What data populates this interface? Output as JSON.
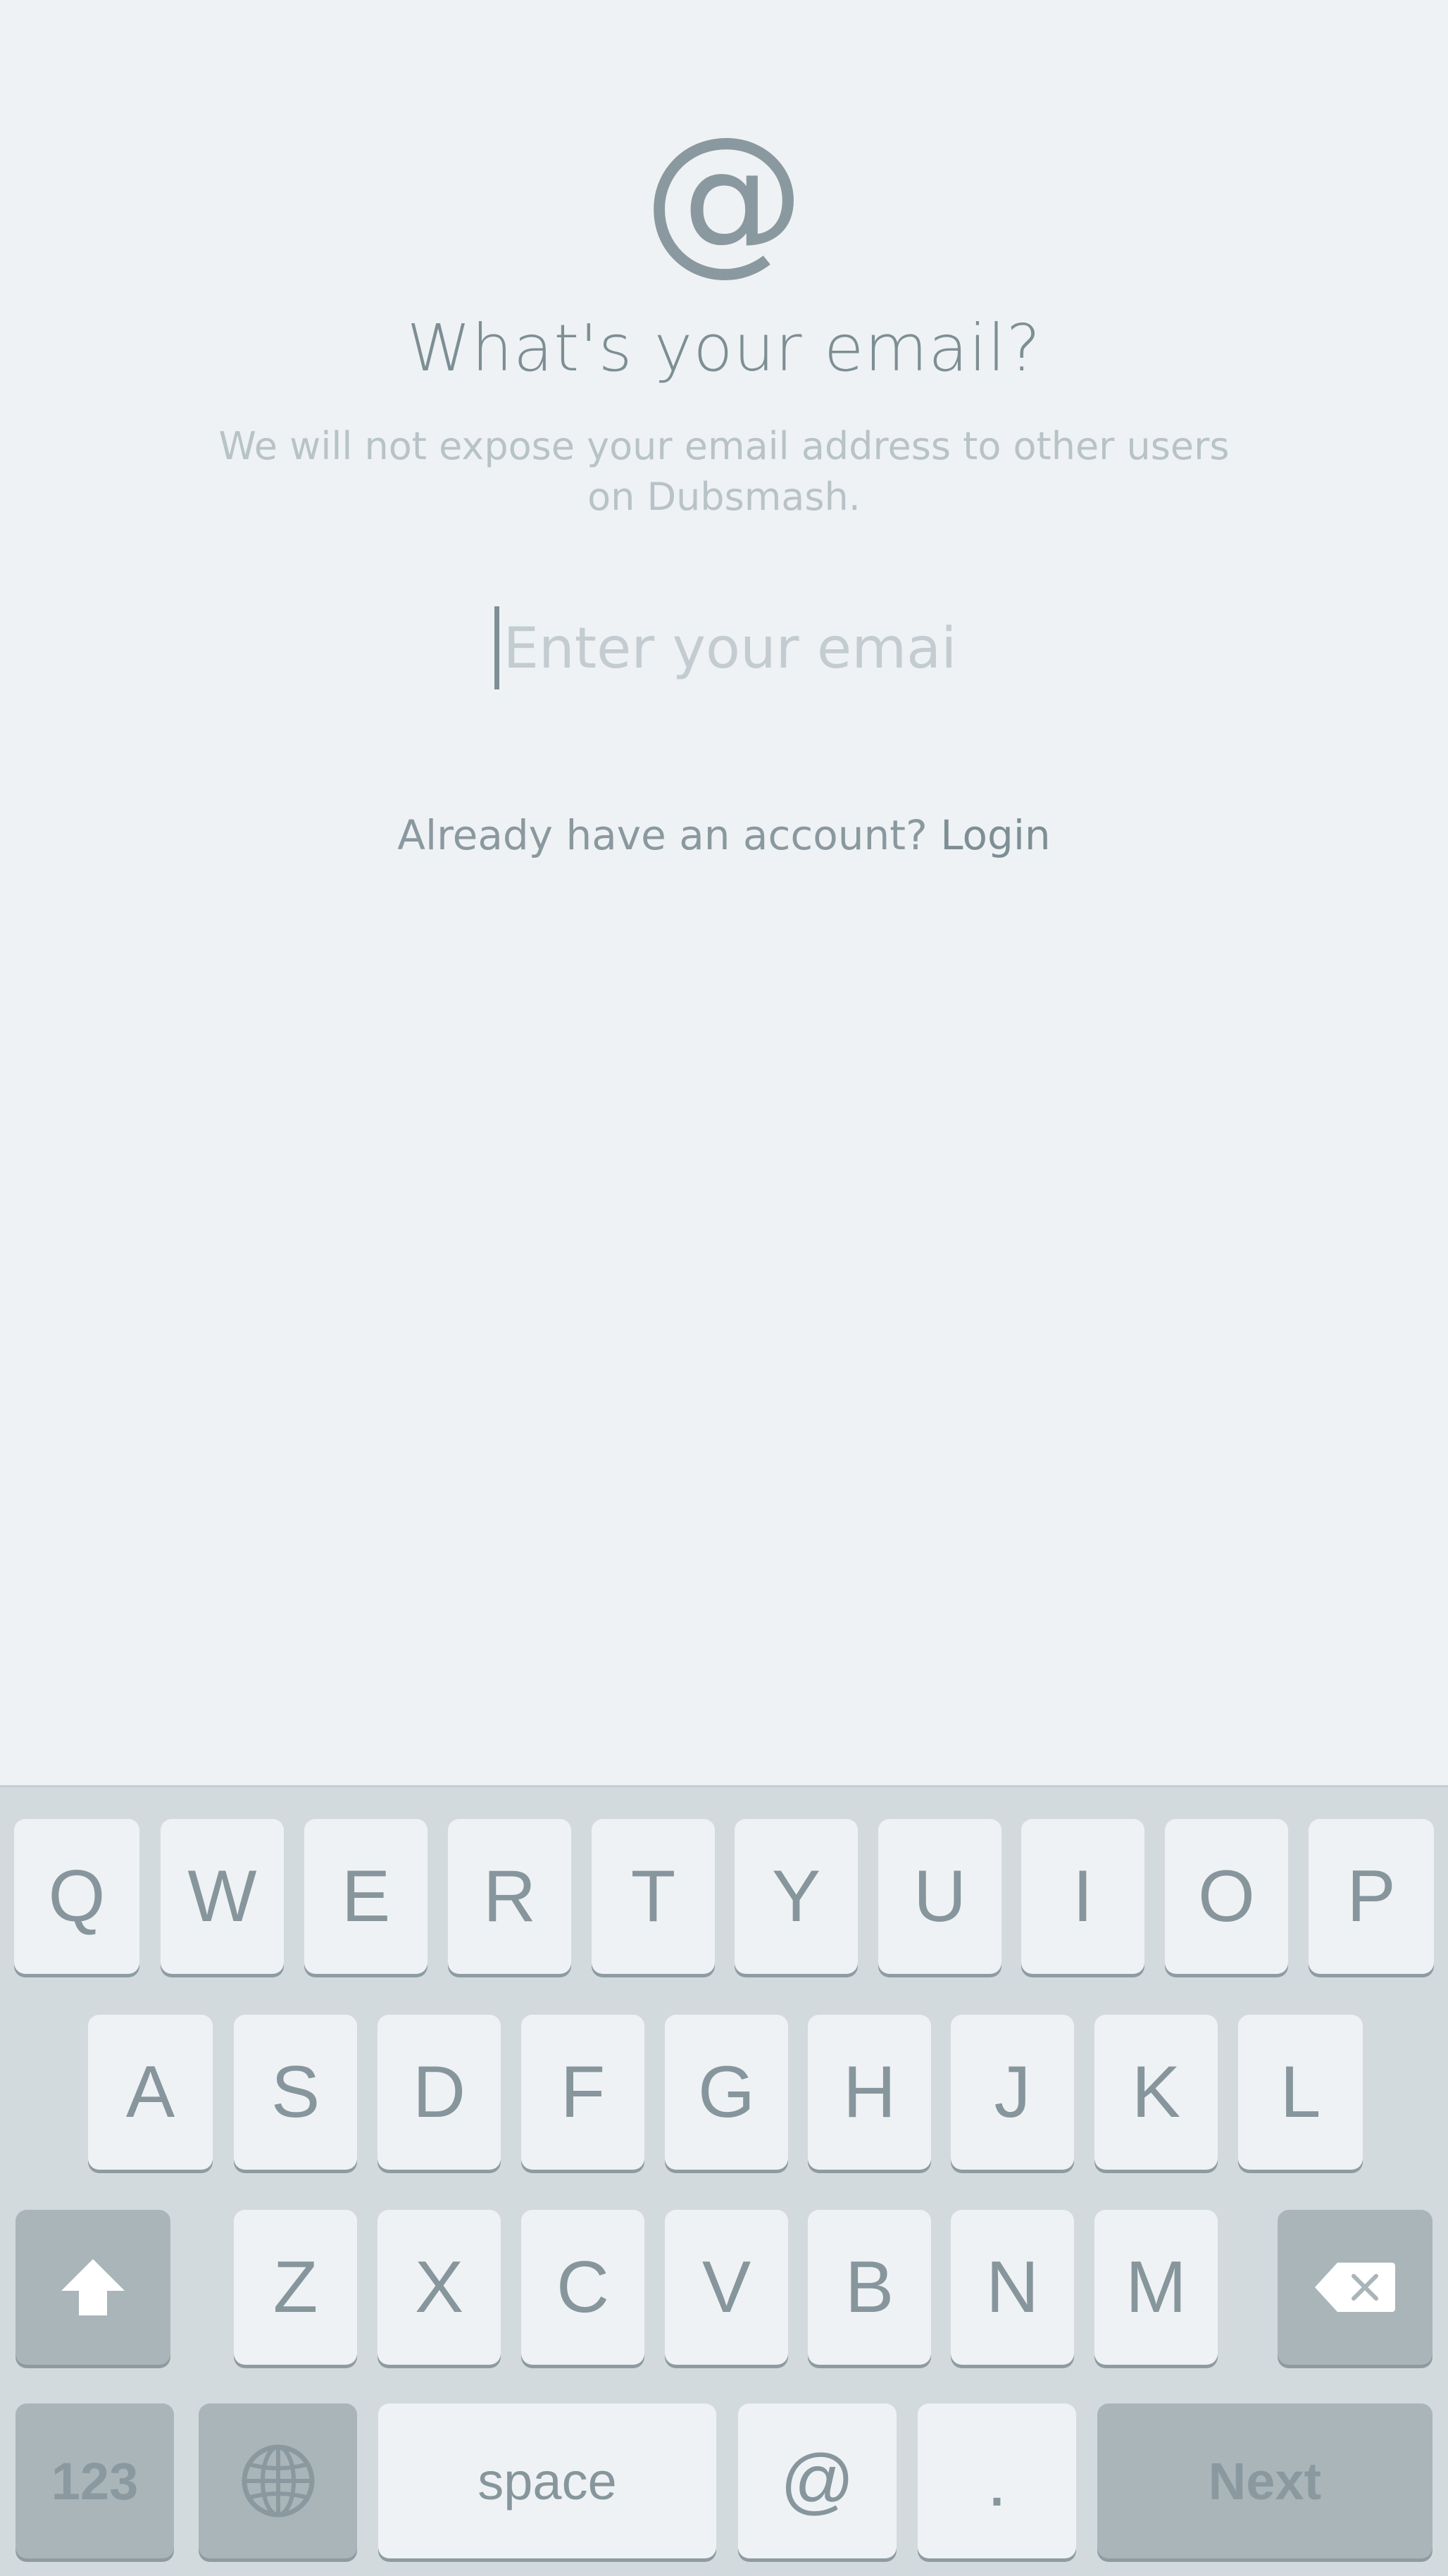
{
  "header": {
    "icon": "at-sign-icon",
    "icon_glyph": "@",
    "title": "What's your email?",
    "subtitle": "We will not expose your email address to other users on Dubsmash."
  },
  "email": {
    "value": "",
    "placeholder": "Enter your email"
  },
  "login": {
    "prompt": "Already have an account?",
    "link": "Login"
  },
  "keyboard": {
    "row1": [
      "Q",
      "W",
      "E",
      "R",
      "T",
      "Y",
      "U",
      "I",
      "O",
      "P"
    ],
    "row2": [
      "A",
      "S",
      "D",
      "F",
      "G",
      "H",
      "J",
      "K",
      "L"
    ],
    "row3": [
      "Z",
      "X",
      "C",
      "V",
      "B",
      "N",
      "M"
    ],
    "shift_icon": "shift-icon",
    "delete_icon": "backspace-icon",
    "numbers_label": "123",
    "globe_icon": "globe-icon",
    "space_label": "space",
    "at_label": "@",
    "dot_label": ".",
    "next_label": "Next"
  },
  "colors": {
    "background": "#eff2f4",
    "text": "#7d8f95",
    "keyboard": "#d3dadd",
    "dark_key": "#a9b5b9"
  }
}
